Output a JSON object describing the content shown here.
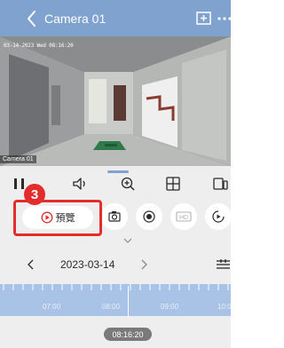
{
  "header": {
    "title": "Camera 01",
    "icons": [
      "back-chevron-icon",
      "add-window-icon",
      "more-dots-icon"
    ]
  },
  "video": {
    "osd_timestamp": "03-14-2023 Wed 08:16:20",
    "camera_label": "Camera 01"
  },
  "toolbar": {
    "icons": [
      "pause-icon",
      "volume-icon",
      "zoom-in-icon",
      "split-screen-icon",
      "multi-channel-icon"
    ]
  },
  "actions": {
    "preview_label": "預覽",
    "step_number": "3",
    "buttons": [
      "snapshot-icon",
      "record-icon",
      "hd-icon",
      "speed-icon"
    ],
    "hd_text": "HD"
  },
  "date_nav": {
    "date": "2023-03-14"
  },
  "timeline": {
    "labels": [
      "07:00",
      "08:00",
      "09:00",
      "10:0"
    ],
    "current_time": "08:16:20"
  },
  "colors": {
    "header": "#7fa2cf",
    "timeline": "#a8c3e6",
    "highlight": "#e32d2d"
  }
}
